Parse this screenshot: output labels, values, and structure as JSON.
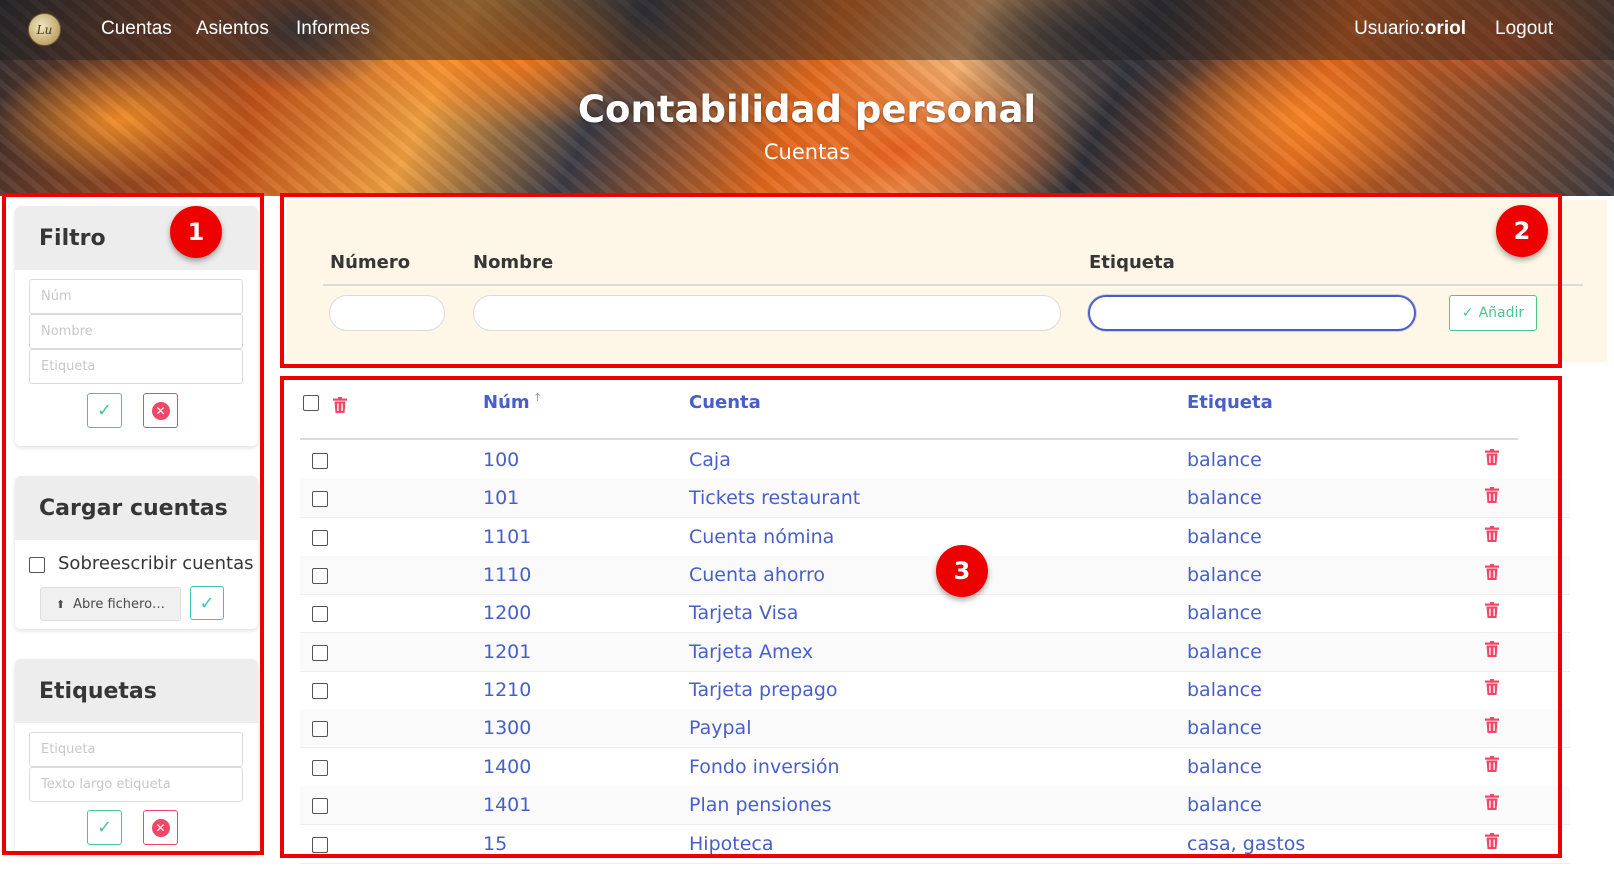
{
  "nav": {
    "logo_text": "Lu",
    "items": [
      "Cuentas",
      "Asientos",
      "Informes"
    ],
    "user_label": "Usuario:",
    "user_name": "oriol",
    "logout": "Logout"
  },
  "hero": {
    "title": "Contabilidad personal",
    "subtitle": "Cuentas"
  },
  "annotations": [
    "1",
    "2",
    "3"
  ],
  "filter": {
    "title": "Filtro",
    "num_placeholder": "Núm",
    "name_placeholder": "Nombre",
    "tag_placeholder": "Etiqueta"
  },
  "load": {
    "title": "Cargar cuentas",
    "overwrite_label": "Sobreescribir cuentas",
    "file_button": "Abre fichero…"
  },
  "tags": {
    "title": "Etiquetas",
    "tag_placeholder": "Etiqueta",
    "long_placeholder": "Texto largo etiqueta"
  },
  "add_form": {
    "col_numero": "Número",
    "col_nombre": "Nombre",
    "col_etiqueta": "Etiqueta",
    "add_button": "Añadir"
  },
  "table": {
    "headers": {
      "num": "Núm",
      "cuenta": "Cuenta",
      "etiqueta": "Etiqueta"
    },
    "rows": [
      {
        "num": "100",
        "cuenta": "Caja",
        "etiqueta": "balance"
      },
      {
        "num": "101",
        "cuenta": "Tickets restaurant",
        "etiqueta": "balance"
      },
      {
        "num": "1101",
        "cuenta": "Cuenta nómina",
        "etiqueta": "balance"
      },
      {
        "num": "1110",
        "cuenta": "Cuenta ahorro",
        "etiqueta": "balance"
      },
      {
        "num": "1200",
        "cuenta": "Tarjeta Visa",
        "etiqueta": "balance"
      },
      {
        "num": "1201",
        "cuenta": "Tarjeta Amex",
        "etiqueta": "balance"
      },
      {
        "num": "1210",
        "cuenta": "Tarjeta prepago",
        "etiqueta": "balance"
      },
      {
        "num": "1300",
        "cuenta": "Paypal",
        "etiqueta": "balance"
      },
      {
        "num": "1400",
        "cuenta": "Fondo inversión",
        "etiqueta": "balance"
      },
      {
        "num": "1401",
        "cuenta": "Plan pensiones",
        "etiqueta": "balance"
      },
      {
        "num": "15",
        "cuenta": "Hipoteca",
        "etiqueta": "casa, gastos"
      }
    ]
  },
  "colors": {
    "link": "#485fc7",
    "success": "#48c78e",
    "danger": "#f14668",
    "annotation": "#e00000",
    "form_bg": "#fef7e7"
  },
  "icons": [
    "check-icon",
    "x-circle-icon",
    "trash-icon",
    "upload-icon",
    "sort-up-icon"
  ]
}
